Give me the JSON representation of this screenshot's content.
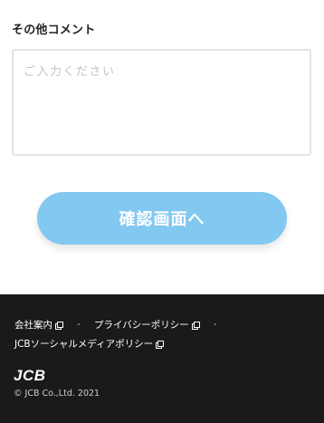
{
  "form": {
    "comment_label": "その他コメント",
    "comment_placeholder": "ご入力ください",
    "comment_value": "",
    "confirm_button_label": "確認画面へ"
  },
  "footer": {
    "links": [
      {
        "label": "会社案内",
        "icon": "external-link-icon"
      },
      {
        "label": "プライバシーポリシー",
        "icon": "external-link-icon"
      },
      {
        "label": "JCBソーシャルメディアポリシー",
        "icon": "external-link-icon"
      }
    ],
    "separator": "・",
    "logo_text": "JCB",
    "copyright": "© JCB Co.,Ltd. 2021"
  },
  "colors": {
    "button_bg": "#82c8f0",
    "footer_bg": "#1a1a1a",
    "input_border": "#e3e3e3"
  }
}
